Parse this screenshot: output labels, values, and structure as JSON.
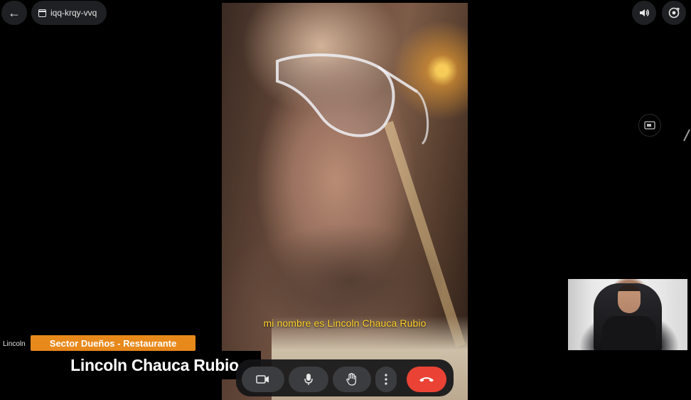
{
  "meeting": {
    "code": "iqq-krqy-vvq"
  },
  "caption": {
    "text": "mi nombre es Lincoln Chauca Rubio"
  },
  "participant": {
    "short_label": "Lincoln"
  },
  "lower_third": {
    "category": "Sector Dueños - Restaurante",
    "name": "Lincoln Chauca Rubio"
  },
  "icons": {
    "back": "arrow-left-icon",
    "meeting": "calendar-icon",
    "volume": "speaker-icon",
    "switch_camera": "camera-switch-icon",
    "camera": "video-camera-icon",
    "mic": "microphone-icon",
    "hand": "raise-hand-icon",
    "more": "more-vertical-icon",
    "end_call": "end-call-icon"
  },
  "colors": {
    "caption_text": "#ffd22a",
    "lower_third_accent": "#e8891c",
    "end_call": "#ea4335",
    "control_button": "#3b3c3f"
  }
}
